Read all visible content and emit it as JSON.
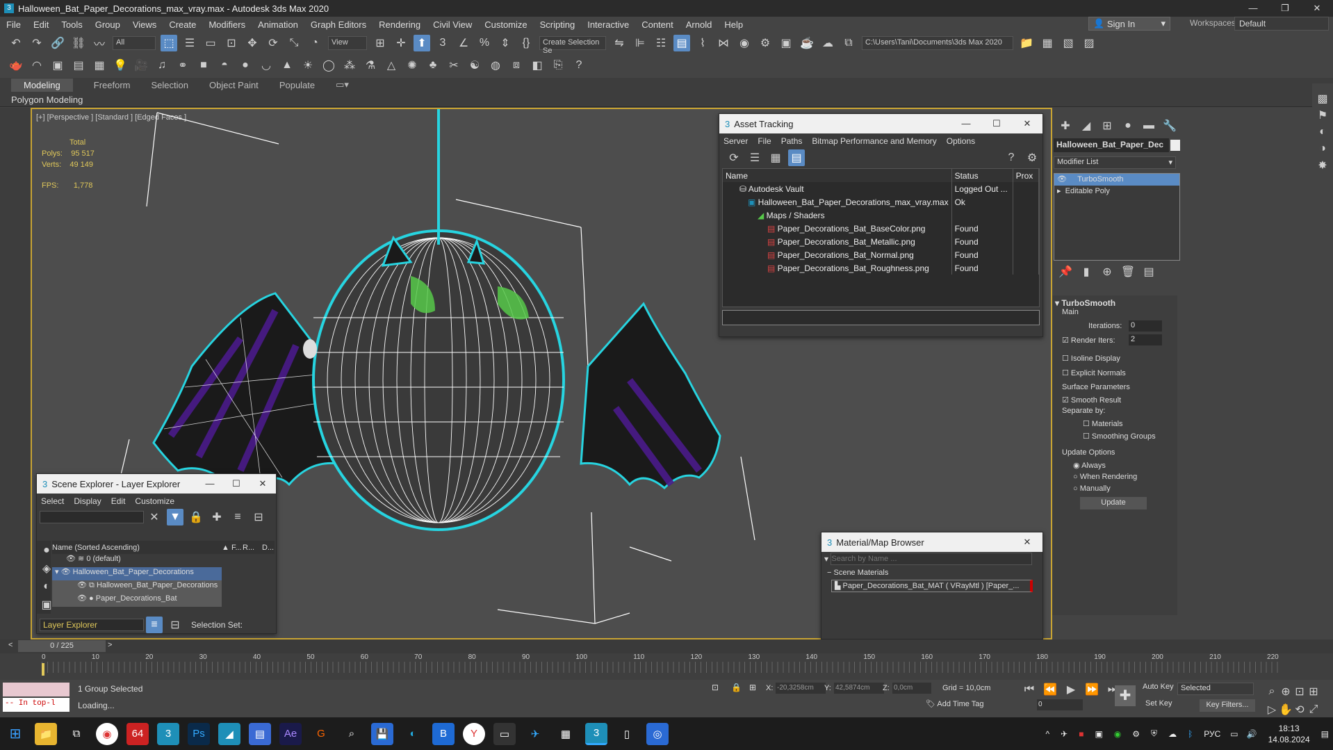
{
  "window": {
    "title": "Halloween_Bat_Paper_Decorations_max_vray.max - Autodesk 3ds Max 2020"
  },
  "menu": [
    "File",
    "Edit",
    "Tools",
    "Group",
    "Views",
    "Create",
    "Modifiers",
    "Animation",
    "Graph Editors",
    "Rendering",
    "Civil View",
    "Customize",
    "Scripting",
    "Interactive",
    "Content",
    "Arnold",
    "Help"
  ],
  "account": {
    "signin": "Sign In",
    "workspaces_label": "Workspaces:",
    "workspace": "Default"
  },
  "toolbar": {
    "filter": "All",
    "view_dropdown": "View",
    "selection_set": "Create Selection Se",
    "path": "C:\\Users\\Tani\\Documents\\3ds Max 2020"
  },
  "ribbon": {
    "tabs": [
      "Modeling",
      "Freeform",
      "Selection",
      "Object Paint",
      "Populate"
    ],
    "active": "Modeling",
    "sub": "Polygon Modeling"
  },
  "viewport": {
    "label": "[+] [Perspective ] [Standard ] [Edged Faces ]",
    "stats_total": "Total",
    "polys_label": "Polys:",
    "polys": "95 517",
    "verts_label": "Verts:",
    "verts": "49 149",
    "fps_label": "FPS:",
    "fps": "1,778"
  },
  "asset_tracking": {
    "title": "Asset Tracking",
    "menu": [
      "Server",
      "File",
      "Paths",
      "Bitmap Performance and Memory",
      "Options"
    ],
    "columns": [
      "Name",
      "Status",
      "Prox"
    ],
    "rows": [
      {
        "name": "Autodesk Vault",
        "status": "Logged Out ..."
      },
      {
        "name": "Halloween_Bat_Paper_Decorations_max_vray.max",
        "status": "Ok"
      },
      {
        "name": "Maps / Shaders",
        "status": ""
      },
      {
        "name": "Paper_Decorations_Bat_BaseColor.png",
        "status": "Found"
      },
      {
        "name": "Paper_Decorations_Bat_Metallic.png",
        "status": "Found"
      },
      {
        "name": "Paper_Decorations_Bat_Normal.png",
        "status": "Found"
      },
      {
        "name": "Paper_Decorations_Bat_Roughness.png",
        "status": "Found"
      }
    ]
  },
  "scene_explorer": {
    "title": "Scene Explorer - Layer Explorer",
    "menu": [
      "Select",
      "Display",
      "Edit",
      "Customize"
    ],
    "col_name": "Name (Sorted Ascending)",
    "col_f": "▲ F...",
    "col_r": "R...",
    "col_d": "D...",
    "rows": [
      "0 (default)",
      "Halloween_Bat_Paper_Decorations",
      "Halloween_Bat_Paper_Decorations",
      "Paper_Decorations_Bat"
    ],
    "footer_explorer": "Layer Explorer",
    "footer_selection": "Selection Set:"
  },
  "material_browser": {
    "title": "Material/Map Browser",
    "search_placeholder": "Search by Name ...",
    "section": "Scene Materials",
    "item": "Paper_Decorations_Bat_MAT ( VRayMtl ) [Paper_..."
  },
  "command_panel": {
    "object_name": "Halloween_Bat_Paper_Dec",
    "modifier_list": "Modifier List",
    "stack": [
      "TurboSmooth",
      "Editable Poly"
    ],
    "rollout": "TurboSmooth",
    "main": "Main",
    "iterations_label": "Iterations:",
    "iterations": "0",
    "render_iters_label": "Render Iters:",
    "render_iters": "2",
    "isoline": "Isoline Display",
    "explicit": "Explicit Normals",
    "surface": "Surface Parameters",
    "smooth_result": "Smooth Result",
    "separate": "Separate by:",
    "materials": "Materials",
    "smoothing_groups": "Smoothing Groups",
    "update_options": "Update Options",
    "always": "Always",
    "when_rendering": "When Rendering",
    "manually": "Manually",
    "update_btn": "Update"
  },
  "timeline": {
    "frame": "0 / 225",
    "ticks": [
      "0",
      "10",
      "20",
      "30",
      "40",
      "50",
      "60",
      "70",
      "80",
      "90",
      "100",
      "110",
      "120",
      "130",
      "140",
      "150",
      "160",
      "170",
      "180",
      "190",
      "200",
      "210",
      "220"
    ]
  },
  "status": {
    "script": "-- In top-l",
    "selected": "1 Group Selected",
    "loading": "Loading...",
    "x_label": "X:",
    "x": "-20,3258cm",
    "y_label": "Y:",
    "y": "42,5874cm",
    "z_label": "Z:",
    "z": "0,0cm",
    "grid": "Grid = 10,0cm",
    "add_time_tag": "Add Time Tag",
    "auto_key": "Auto Key",
    "set_key": "Set Key",
    "selected_dd": "Selected",
    "key_filters": "Key Filters...",
    "frame_field": "0"
  },
  "taskbar": {
    "lang": "РУС",
    "time": "18:13",
    "date": "14.08.2024"
  },
  "colors": {
    "accent": "#5a8bc4",
    "viewport_border": "#c8a433",
    "wire": "#ffffff",
    "highlight": "#27d4e0",
    "bat_purple": "#4a1a8a",
    "pumpkin_green": "#57c94a"
  }
}
